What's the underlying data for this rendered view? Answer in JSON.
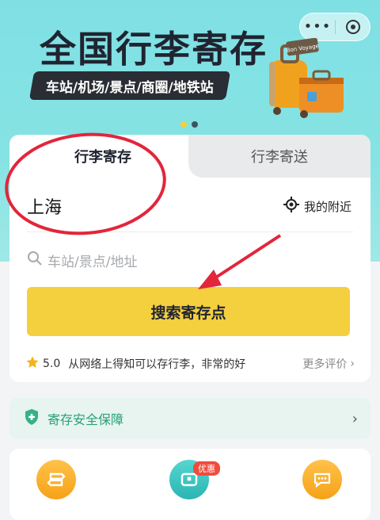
{
  "hero": {
    "title": "全国行李寄存",
    "subtitle": "车站/机场/景点/商圈/地铁站",
    "luggage_sticker_text": "Bon Voyage",
    "pager_active_color": "#f4d03f",
    "pager_inactive_color": "#3b5560"
  },
  "capsule": {
    "more_icon": "more-dots-icon",
    "close_icon": "target-close-icon"
  },
  "tabs": [
    {
      "label": "行李寄存",
      "active": true
    },
    {
      "label": "行李寄送",
      "active": false
    }
  ],
  "location": {
    "city": "上海",
    "nearby_label": "我的附近",
    "nearby_icon": "locate-icon"
  },
  "search": {
    "placeholder": "车站/景点/地址",
    "button_label": "搜索寄存点"
  },
  "review": {
    "rating": "5.0",
    "text": "从网络上得知可以存行李，非常的好",
    "more_label": "更多评价"
  },
  "safety": {
    "label": "寄存安全保障",
    "icon": "shield-plus-icon"
  },
  "bottom_icons": [
    {
      "icon": "signpost-icon"
    },
    {
      "icon": "ticket-icon",
      "badge": "优惠"
    },
    {
      "icon": "chat-icon"
    }
  ],
  "colors": {
    "accent_yellow": "#f4d03f",
    "safety_green": "#29a07a",
    "annotation_red": "#e2263b"
  }
}
